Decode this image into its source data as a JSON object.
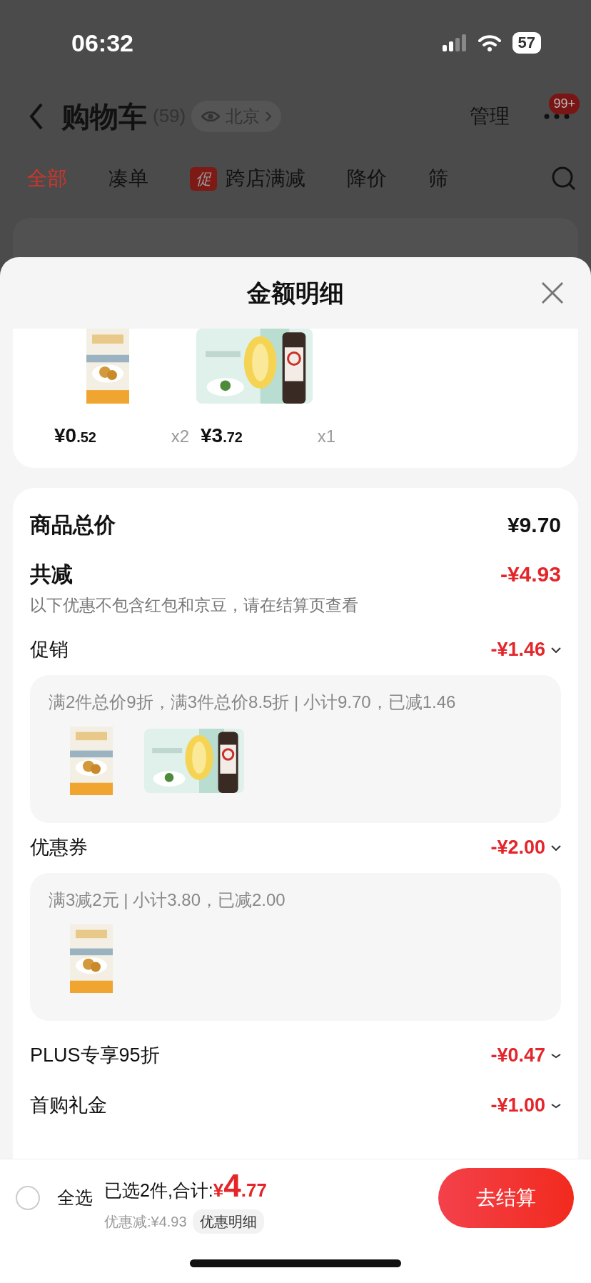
{
  "status_bar": {
    "time": "06:32",
    "battery": "57"
  },
  "header": {
    "title": "购物车",
    "count": "(59)",
    "location": "北京",
    "manage": "管理",
    "badge": "99+"
  },
  "tabs": [
    {
      "label": "全部",
      "selected": true
    },
    {
      "label": "凑单",
      "selected": false
    },
    {
      "label": "跨店满减",
      "selected": false,
      "tag": "促"
    },
    {
      "label": "降价",
      "selected": false
    },
    {
      "label": "筛",
      "selected": false
    }
  ],
  "sheet": {
    "title": "金额明细",
    "items": [
      {
        "kind": "picture",
        "price": "¥0.52",
        "qty": "x2"
      },
      {
        "kind": "picture",
        "price": "¥3.72",
        "qty": "x1"
      }
    ],
    "summary": {
      "total_label": "商品总价",
      "total": "¥9.70",
      "discount_label": "共减",
      "discount": "-¥4.93",
      "note": "以下优惠不包含红包和京豆，请在结算页查看"
    },
    "discounts": [
      {
        "label": "促销",
        "amount": "-¥1.46",
        "expanded": true,
        "detail": "满2件总价9折，满3件总价8.5折 | 小计9.70，已减1.46"
      },
      {
        "label": "优惠券",
        "amount": "-¥2.00",
        "expanded": true,
        "detail": "满3减2元 | 小计3.80，已减2.00"
      },
      {
        "label": "PLUS专享95折",
        "amount": "-¥0.47",
        "expanded": false
      },
      {
        "label": "首购礼金",
        "amount": "-¥1.00",
        "expanded": false
      }
    ]
  },
  "bottom_bar": {
    "select_all": "全选",
    "checked": false,
    "selected_text": "已选2件,合计:",
    "total": "¥4.77",
    "saved": "优惠减:¥4.93",
    "detail_chip": "优惠明细",
    "checkout": "去结算"
  }
}
